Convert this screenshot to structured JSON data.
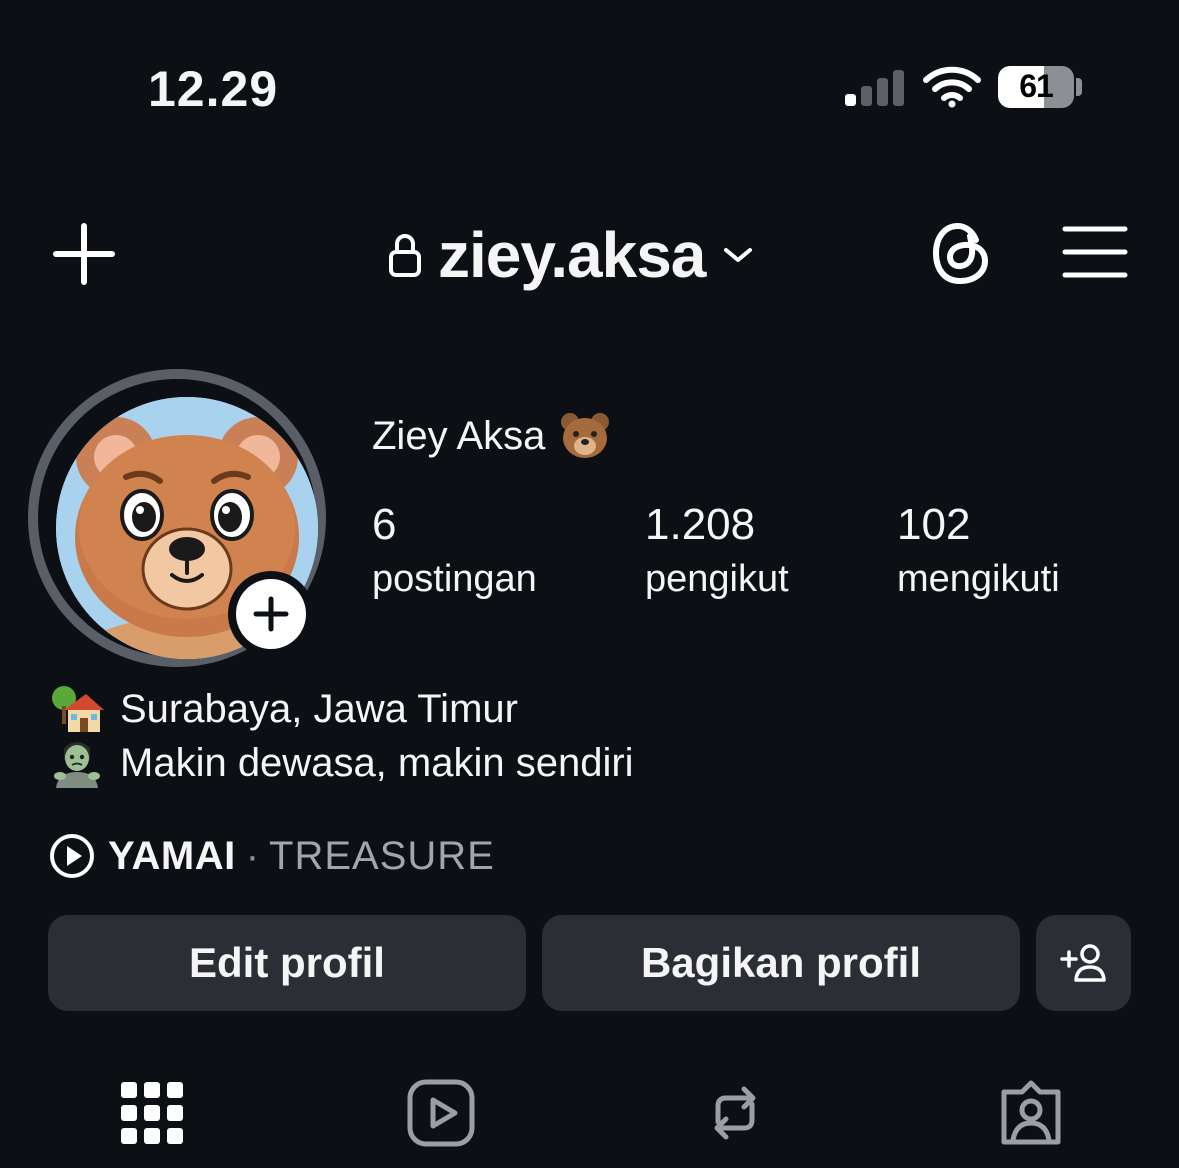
{
  "status_bar": {
    "time": "12.29",
    "battery": "61",
    "battery_level": 0.61,
    "signal_bars_active": 1,
    "signal_bars_total": 4
  },
  "header": {
    "username": "ziey.aksa",
    "icons": [
      "plus-icon",
      "lock-icon",
      "chevron-down-icon",
      "threads-icon",
      "menu-icon"
    ]
  },
  "profile": {
    "display_name": "Ziey Aksa",
    "stats": [
      {
        "value": "6",
        "label": "postingan"
      },
      {
        "value": "1.208",
        "label": "pengikut"
      },
      {
        "value": "102",
        "label": "mengikuti"
      }
    ],
    "bio": [
      {
        "icon": "house-with-tree-emoji",
        "text": "Surabaya, Jawa Timur"
      },
      {
        "icon": "zombie-emoji",
        "text": "Makin dewasa, makin sendiri"
      }
    ],
    "music": {
      "song": "YAMAI",
      "separator": "·",
      "artist": "TREASURE"
    }
  },
  "actions": {
    "edit": "Edit profil",
    "share": "Bagikan profil"
  },
  "tabs": [
    "grid-icon",
    "reels-icon",
    "reposts-icon",
    "tagged-icon"
  ],
  "colors": {
    "background": "#0c0f14",
    "button_bg": "#2b2e35",
    "text": "#f5f5f5",
    "muted": "#a2a5aa"
  }
}
